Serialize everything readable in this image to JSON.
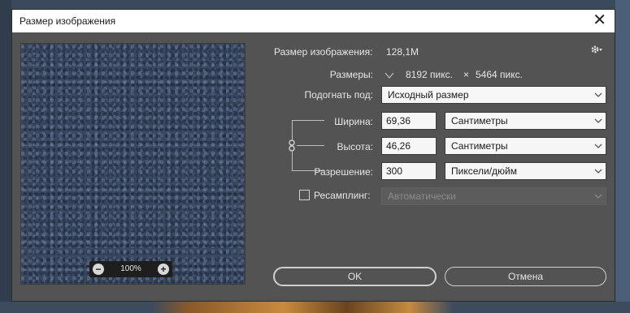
{
  "dialog": {
    "title": "Размер изображения",
    "close_glyph": "✕"
  },
  "preview": {
    "zoom_value": "100%",
    "zoom_out_glyph": "−",
    "zoom_in_glyph": "+"
  },
  "info": {
    "image_size_label": "Размер изображения:",
    "image_size_value": "128,1M",
    "dimensions_label": "Размеры:",
    "width_px": "8192 пикс.",
    "times": "×",
    "height_px": "5464 пикс."
  },
  "fit": {
    "label": "Подогнать под:",
    "value": "Исходный размер"
  },
  "width": {
    "label": "Ширина:",
    "value": "69,36",
    "unit": "Сантиметры"
  },
  "height": {
    "label": "Высота:",
    "value": "46,26",
    "unit": "Сантиметры"
  },
  "resolution": {
    "label": "Разрешение:",
    "value": "300",
    "unit": "Пиксели/дюйм"
  },
  "resample": {
    "label": "Ресамплинг:",
    "checked": false,
    "value": "Автоматически"
  },
  "buttons": {
    "ok": "OK",
    "cancel": "Отмена"
  },
  "icons": {
    "gear": "gear-icon",
    "chain": "chain-link-icon",
    "dimensions_chevron": "chevron-down-icon",
    "dropdown_chevron": "chevron-down-icon"
  },
  "colors": {
    "dialog_bg": "#535353",
    "field_bg": "#f6f6f6",
    "text": "#e6e6e6"
  }
}
